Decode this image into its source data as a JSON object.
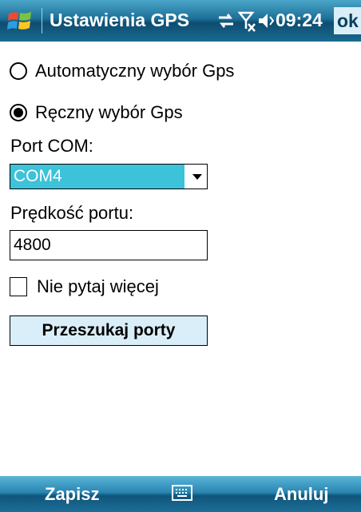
{
  "titlebar": {
    "title": "Ustawienia GPS",
    "time": "09:24",
    "ok_label": "ok",
    "icons": [
      "windows-start-icon",
      "connectivity-icon",
      "signal-off-icon",
      "volume-icon"
    ]
  },
  "options": {
    "auto_label": "Automatyczny wybór Gps",
    "manual_label": "Ręczny wybór Gps",
    "selected": "manual"
  },
  "port": {
    "label": "Port COM:",
    "value": "COM4"
  },
  "speed": {
    "label": "Prędkość portu:",
    "value": "4800"
  },
  "ask_again": {
    "label": "Nie pytaj więcej",
    "checked": false
  },
  "scan_button": "Przeszukaj porty",
  "softkeys": {
    "left": "Zapisz",
    "right": "Anuluj",
    "center_icon": "keyboard-icon"
  },
  "colors": {
    "titlebar": "#1d6f97",
    "combo_highlight": "#3cc2d9",
    "button_bg": "#d9eef8"
  }
}
